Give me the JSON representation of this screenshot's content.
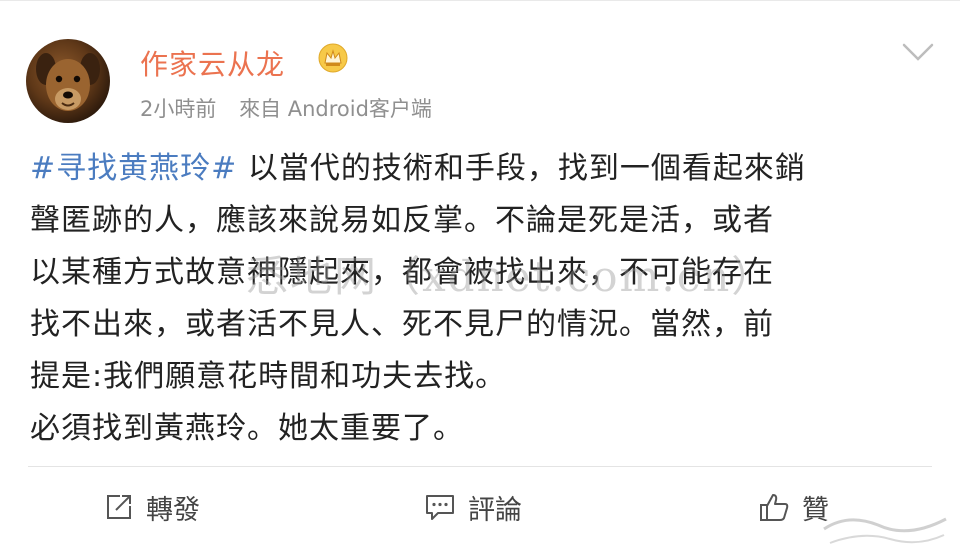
{
  "post": {
    "author": "作家云从龙",
    "time": "2小時前",
    "source": "來自 Android客户端",
    "hashtag": "#寻找黄燕玲#",
    "lines": [
      " 以當代的技術和手段，找到一個看起來銷",
      "聲匿跡的人，應該來說易如反掌。不論是死是活，或者",
      "以某種方式故意神隱起來，都會被找出來，不可能存在",
      "找不出來，或者活不見人、死不見尸的情況。當然，前",
      "提是:我們願意花時間和功夫去找。",
      "必須找到黃燕玲。她太重要了。"
    ]
  },
  "watermark": "悉地网（xdnet.com.cn）",
  "actions": {
    "repost": "轉發",
    "comment": "評論",
    "like": "贊"
  },
  "icons": [
    "crown-badge-icon",
    "chevron-down-icon",
    "repost-icon",
    "comment-icon",
    "thumbs-up-icon"
  ],
  "colors": {
    "author": "#eb7350",
    "hashtag": "#4b7cc0",
    "text": "#222222",
    "meta": "#8f8f8f"
  }
}
